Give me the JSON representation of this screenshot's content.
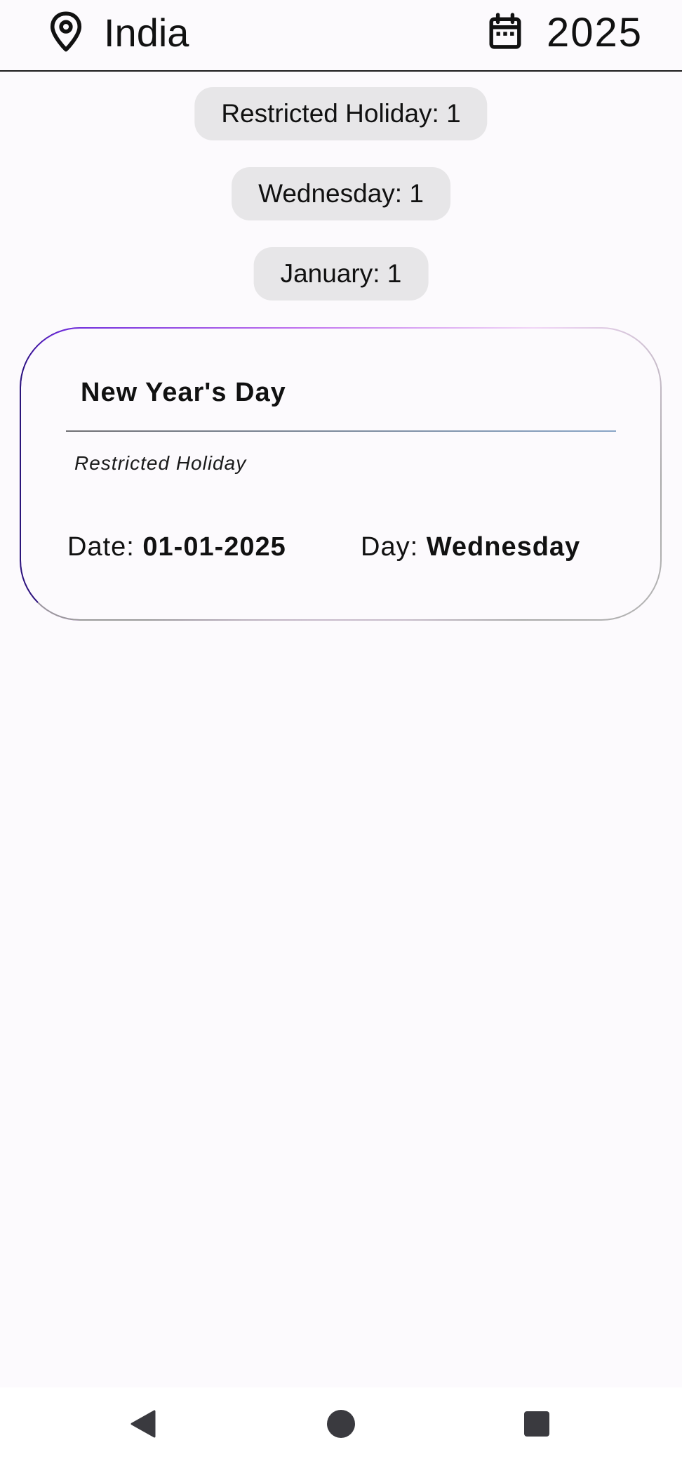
{
  "header": {
    "location_icon": "location-pin-icon",
    "location": "India",
    "calendar_icon": "calendar-icon",
    "year": "2025"
  },
  "filters": [
    {
      "label": "Restricted Holiday: 1"
    },
    {
      "label": "Wednesday: 1"
    },
    {
      "label": "January: 1"
    }
  ],
  "holiday": {
    "name": "New Year's Day",
    "type": "Restricted Holiday",
    "date_label": "Date: ",
    "date": "01-01-2025",
    "day_label": "Day: ",
    "day": "Wednesday"
  },
  "system_nav": {
    "back_icon": "back-triangle-icon",
    "home_icon": "home-circle-icon",
    "recent_icon": "recent-square-icon"
  },
  "colors": {
    "background": "#fcfafd",
    "chip_background": "#e7e6e8",
    "card_border_start": "#5a18d6",
    "card_border_end": "#b5b5b5"
  }
}
